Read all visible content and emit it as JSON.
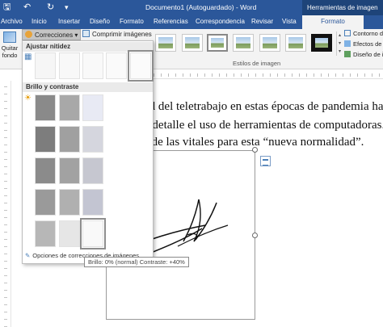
{
  "titlebar": {
    "doc_title": "Documento1 (Autoguardado) - Word",
    "context_group": "Herramientas de imagen"
  },
  "tabs": [
    "Archivo",
    "Inicio",
    "Insertar",
    "Diseño",
    "Formato",
    "Referencias",
    "Correspondencia",
    "Revisar",
    "Vista",
    "Formato"
  ],
  "ribbon": {
    "remove_bg_label_1": "Quitar",
    "remove_bg_label_2": "fondo",
    "corrections_label": "Correcciones",
    "compress_label": "Comprimir imágenes",
    "styles_group_label": "Estilos de imagen",
    "border_label": "Contorno de",
    "effects_label": "Efectos de i",
    "layout_label": "Diseño de i"
  },
  "corrections_menu": {
    "sharpen_header": "Ajustar nitidez",
    "brightness_header": "Brillo y contraste",
    "options_label": "Opciones de correcciones de imágenes...",
    "tooltip": "Brillo: 0% (normal) Contraste: +40%"
  },
  "document": {
    "lines": [
      "ad del teletrabajo en estas épocas de pandemia ha",
      "a detalle el uso de herramientas de computadoras. D",
      "s de las vitales para esta “nueva normalidad”."
    ]
  }
}
